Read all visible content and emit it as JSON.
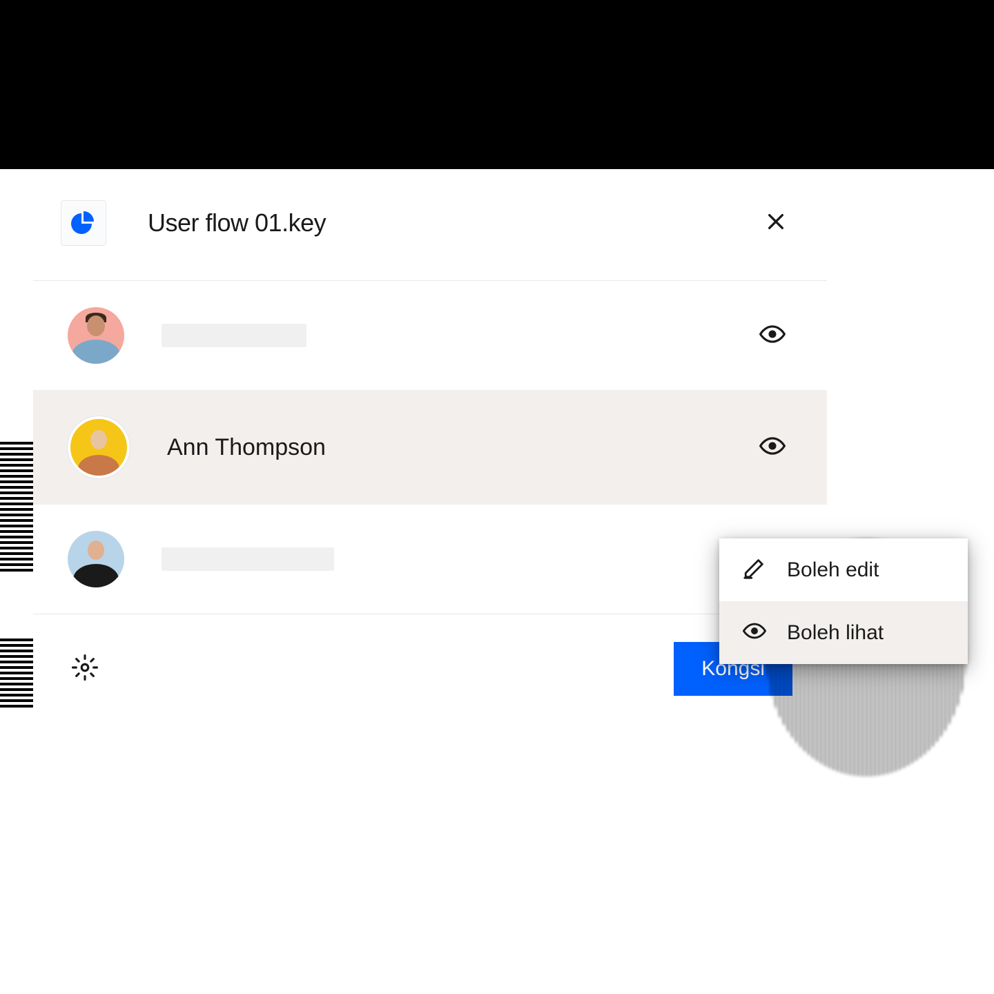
{
  "header": {
    "file_name": "User flow 01.key"
  },
  "people": [
    {
      "name": "",
      "permission_icon": "eye-icon"
    },
    {
      "name": "Ann Thompson",
      "permission_icon": "eye-icon"
    },
    {
      "name": "",
      "permission_icon": ""
    }
  ],
  "dropdown": {
    "edit_label": "Boleh edit",
    "view_label": "Boleh lihat"
  },
  "footer": {
    "share_label": "Kongsi"
  },
  "icons": {
    "pie_chart": "pie-chart-icon",
    "close": "close-icon",
    "eye": "eye-icon",
    "pencil": "pencil-icon",
    "gear": "gear-icon"
  },
  "colors": {
    "primary": "#0061fe",
    "highlight": "#f2efed"
  }
}
